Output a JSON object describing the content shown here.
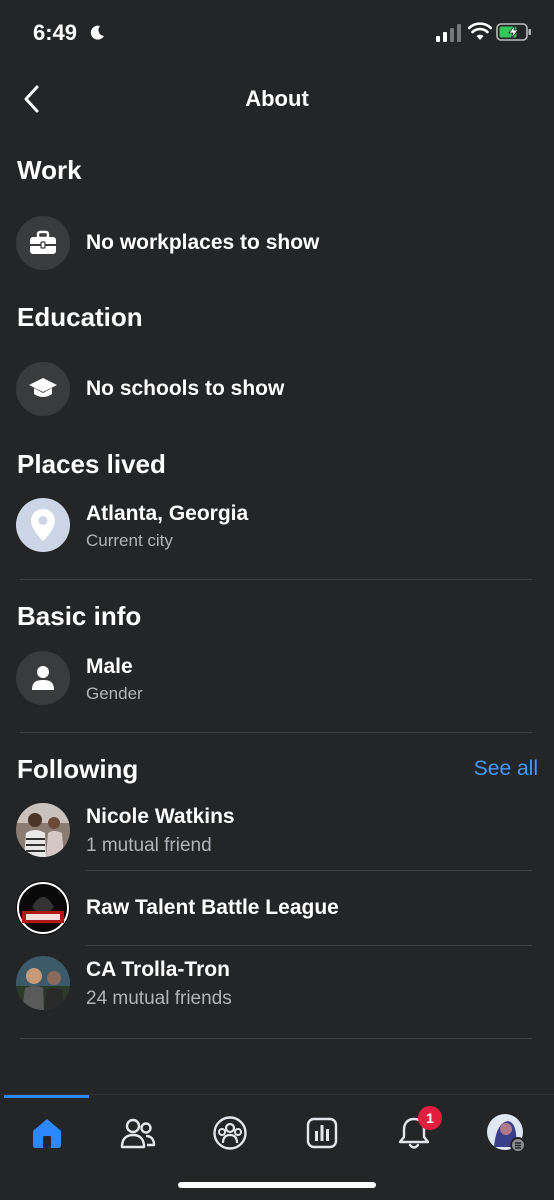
{
  "status_bar": {
    "time": "6:49"
  },
  "header": {
    "title": "About"
  },
  "work": {
    "title": "Work",
    "text": "No workplaces to show"
  },
  "education": {
    "title": "Education",
    "text": "No schools to show"
  },
  "places": {
    "title": "Places lived",
    "city": "Atlanta, Georgia",
    "label": "Current city"
  },
  "basic_info": {
    "title": "Basic info",
    "gender": "Male",
    "label": "Gender"
  },
  "following": {
    "title": "Following",
    "see_all": "See all",
    "items": [
      {
        "name": "Nicole Watkins",
        "sub": "1 mutual friend"
      },
      {
        "name": "Raw Talent Battle League",
        "sub": ""
      },
      {
        "name": "CA Trolla-Tron",
        "sub": "24 mutual friends"
      }
    ]
  },
  "tab_bar": {
    "notification_count": "1",
    "tabs": [
      "home-icon",
      "friends-icon",
      "groups-icon",
      "dashboard-icon",
      "notifications-icon",
      "profile-icon"
    ]
  },
  "colors": {
    "accent": "#2d88ff",
    "link": "#4599ff",
    "badge": "#e41e3f",
    "background": "#242526"
  }
}
